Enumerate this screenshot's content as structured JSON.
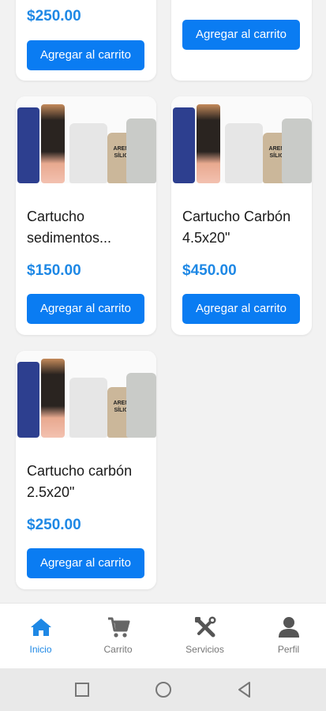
{
  "products": [
    {
      "name": "",
      "price": "$250.00",
      "button": "Agregar al carrito"
    },
    {
      "name": "",
      "price": "",
      "button": "Agregar al carrito"
    },
    {
      "name": "Cartucho sedimentos...",
      "price": "$150.00",
      "button": "Agregar al carrito"
    },
    {
      "name": "Cartucho Carbón 4.5x20\"",
      "price": "$450.00",
      "button": "Agregar al carrito"
    },
    {
      "name": "Cartucho carbón 2.5x20\"",
      "price": "$250.00",
      "button": "Agregar al carrito"
    }
  ],
  "product_image_text": "ARENA SÍLICA",
  "bottom_nav": [
    {
      "label": "Inicio",
      "icon": "home-icon",
      "active": true
    },
    {
      "label": "Carrito",
      "icon": "cart-icon",
      "active": false
    },
    {
      "label": "Servicios",
      "icon": "tools-icon",
      "active": false
    },
    {
      "label": "Perfil",
      "icon": "person-icon",
      "active": false
    }
  ],
  "colors": {
    "accent": "#1e88e5",
    "button": "#0a7cf2",
    "background": "#f2f2f2"
  }
}
